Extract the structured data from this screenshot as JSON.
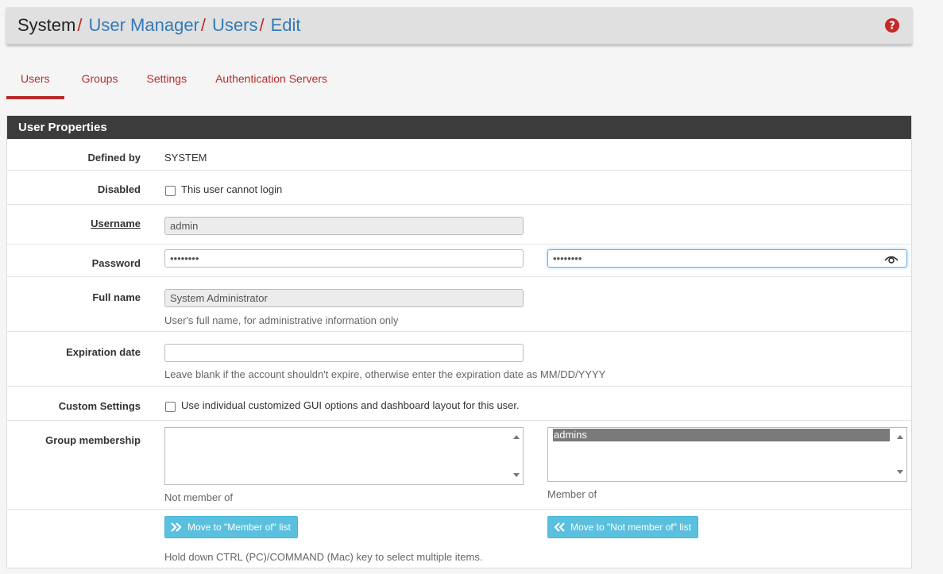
{
  "breadcrumb": {
    "root": "System",
    "items": [
      "User Manager",
      "Users",
      "Edit"
    ],
    "separator": "/"
  },
  "help_icon": "question-circle-icon",
  "tabs": [
    {
      "label": "Users",
      "active": true
    },
    {
      "label": "Groups",
      "active": false
    },
    {
      "label": "Settings",
      "active": false
    },
    {
      "label": "Authentication Servers",
      "active": false
    }
  ],
  "panel": {
    "title": "User Properties",
    "defined_by": {
      "label": "Defined by",
      "value": "SYSTEM"
    },
    "disabled": {
      "label": "Disabled",
      "checkbox_label": "This user cannot login",
      "checked": false
    },
    "username": {
      "label": "Username",
      "value": "admin"
    },
    "password": {
      "label": "Password",
      "value": "••••••••",
      "confirm_value": "••••••••",
      "reveal_icon": "eye-icon"
    },
    "full_name": {
      "label": "Full name",
      "value": "System Administrator",
      "help": "User's full name, for administrative information only"
    },
    "expiration": {
      "label": "Expiration date",
      "value": "",
      "help": "Leave blank if the account shouldn't expire, otherwise enter the expiration date as MM/DD/YYYY"
    },
    "custom_settings": {
      "label": "Custom Settings",
      "checkbox_label": "Use individual customized GUI options and dashboard layout for this user.",
      "checked": false
    },
    "group_membership": {
      "label": "Group membership",
      "not_member_of": [],
      "not_member_label": "Not member of",
      "member_of": [
        "admins"
      ],
      "member_label": "Member of",
      "move_to_member_btn": "Move to \"Member of\" list",
      "move_to_not_member_btn": "Move to \"Not member of\" list",
      "help": "Hold down CTRL (PC)/COMMAND (Mac) key to select multiple items."
    }
  },
  "colors": {
    "accent": "#b92b2b",
    "link": "#337ab7",
    "info_button": "#5bc0de",
    "panel_heading": "#3c3c3c"
  }
}
